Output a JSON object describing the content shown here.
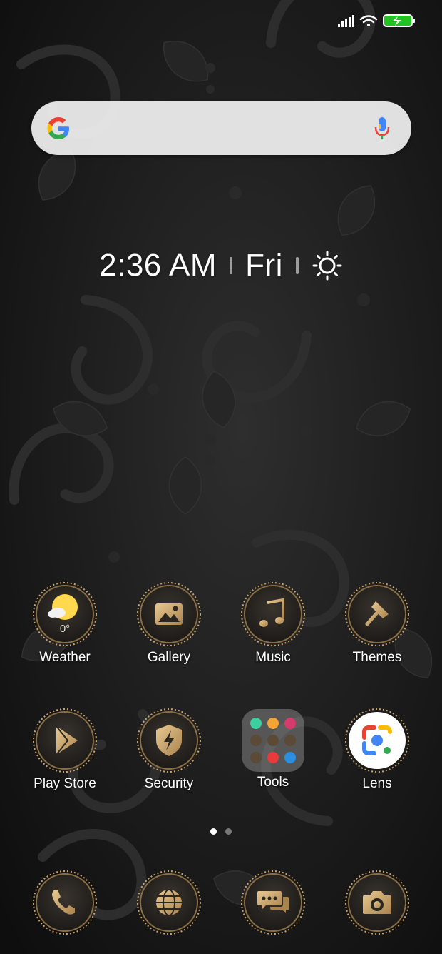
{
  "search": {
    "placeholder": "",
    "icons": {
      "logo": "google-g-icon",
      "voice": "mic-icon"
    }
  },
  "clock": {
    "time": "2:36 AM",
    "day": "Fri",
    "weather_icon": "sun-icon"
  },
  "status": {
    "signal": "signal-bars-icon",
    "wifi": "wifi-icon",
    "battery": "battery-charging-icon"
  },
  "apps_row1": [
    {
      "label": "Weather",
      "icon": "weather-icon",
      "temp": "0°"
    },
    {
      "label": "Gallery",
      "icon": "gallery-icon"
    },
    {
      "label": "Music",
      "icon": "music-note-icon"
    },
    {
      "label": "Themes",
      "icon": "paintbrush-icon"
    }
  ],
  "apps_row2": [
    {
      "label": "Play Store",
      "icon": "play-store-icon"
    },
    {
      "label": "Security",
      "icon": "shield-bolt-icon"
    },
    {
      "label": "Tools",
      "icon": "folder-icon"
    },
    {
      "label": "Lens",
      "icon": "google-lens-icon"
    }
  ],
  "pages": {
    "count": 2,
    "current": 1
  },
  "dock": [
    {
      "icon": "phone-icon"
    },
    {
      "icon": "browser-globe-icon"
    },
    {
      "icon": "messages-icon"
    },
    {
      "icon": "camera-icon"
    }
  ],
  "colors": {
    "gold": "#c9a36b",
    "badge_dark": "#2a2622",
    "accent_white": "#ffffff"
  }
}
